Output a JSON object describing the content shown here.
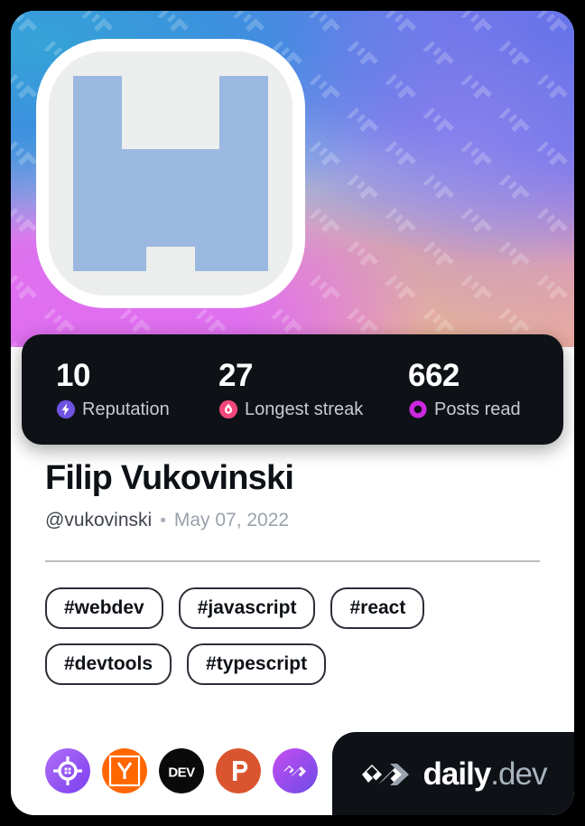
{
  "card": {
    "avatar_alt": "pixel-identicon-avatar",
    "cover_pattern": "daily-dev-logo-watermark"
  },
  "stats": [
    {
      "value": "10",
      "label": "Reputation",
      "icon": "reputation-bolt-icon",
      "color": "#6e52e0"
    },
    {
      "value": "27",
      "label": "Longest streak",
      "icon": "streak-flame-icon",
      "color": "#f0487a"
    },
    {
      "value": "662",
      "label": "Posts read",
      "icon": "posts-read-ring-icon",
      "color": "#cb28e0"
    }
  ],
  "profile": {
    "name": "Filip Vukovinski",
    "handle": "@vukovinski",
    "separator": "•",
    "joined": "May 07, 2022"
  },
  "tags": [
    "#webdev",
    "#javascript",
    "#react",
    "#devtools",
    "#typescript"
  ],
  "socials": [
    {
      "name": "roadmap-sh-icon",
      "title": "roadmap.sh"
    },
    {
      "name": "ycombinator-icon",
      "title": "Y Combinator"
    },
    {
      "name": "dev-to-icon",
      "title": "DEV"
    },
    {
      "name": "product-hunt-icon",
      "title": "Product Hunt"
    },
    {
      "name": "daily-dev-icon",
      "title": "daily.dev"
    }
  ],
  "brand": {
    "name": "daily",
    "tld": ".dev"
  },
  "colors": {
    "card_bg": "#ffffff",
    "dark_panel": "#0e1217",
    "page_bg": "#000000",
    "divider": "#b9bcc0",
    "tag_border": "#2b2f36"
  }
}
